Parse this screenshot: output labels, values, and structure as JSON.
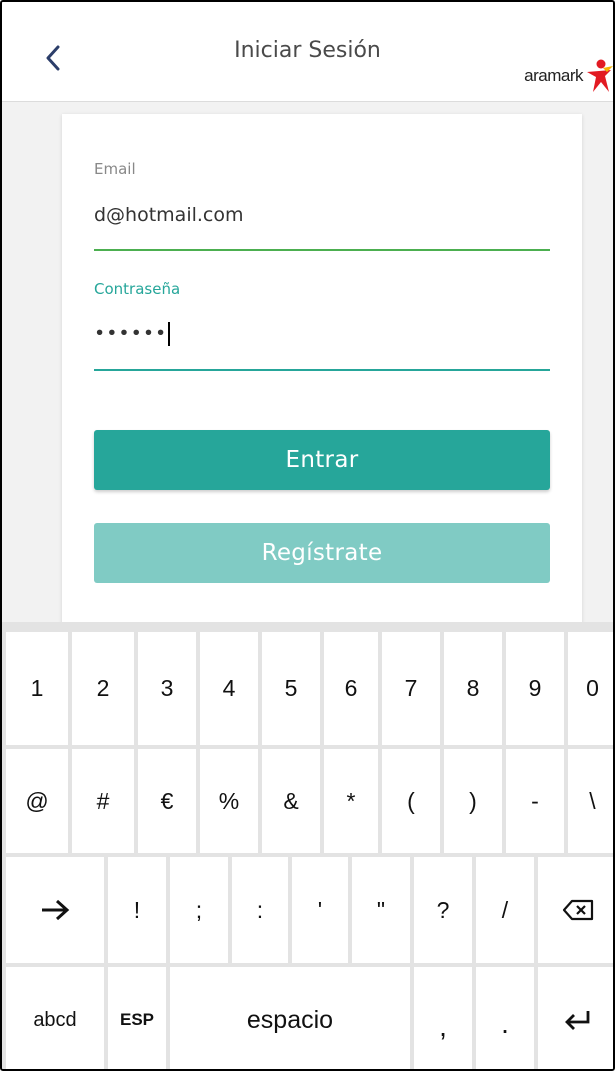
{
  "header": {
    "title": "Iniciar Sesión",
    "logo_text": "aramark"
  },
  "form": {
    "email_label": "Email",
    "email_value": "d@hotmail.com",
    "password_label": "Contraseña",
    "password_value": "••••••",
    "login_button": "Entrar",
    "register_button": "Regístrate"
  },
  "keyboard": {
    "row1": [
      "1",
      "2",
      "3",
      "4",
      "5",
      "6",
      "7",
      "8",
      "9",
      "0"
    ],
    "row2": [
      "@",
      "#",
      "€",
      "%",
      "&",
      "*",
      "(",
      ")",
      "-",
      "\\"
    ],
    "row3": [
      "!",
      ";",
      ":",
      "'",
      "\"",
      "?",
      "/"
    ],
    "row4": {
      "abcd": "abcd",
      "lang": "ESP",
      "space": "espacio",
      "comma": ",",
      "period": "."
    }
  },
  "colors": {
    "primary": "#26a69a",
    "primary_light": "#80cbc4",
    "email_underline": "#4caf50",
    "label_gray": "#888888"
  }
}
